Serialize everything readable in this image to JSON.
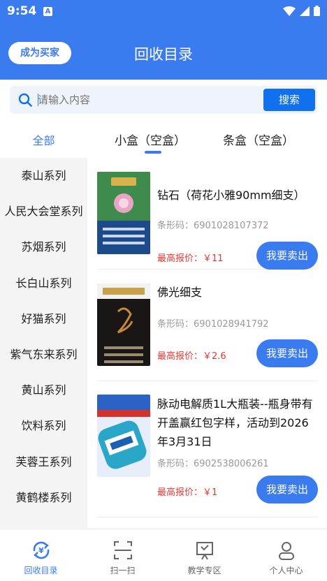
{
  "status_bar": {
    "time": "9:54",
    "notification_letter": "A"
  },
  "header": {
    "title": "回收目录",
    "buyer_button": "成为买家"
  },
  "search": {
    "placeholder": "请输入内容",
    "button": "搜索"
  },
  "tabs": {
    "all": "全部",
    "items": [
      "小盒（空盒）",
      "条盒（空盒）"
    ],
    "active_index": 0
  },
  "sidebar": {
    "items": [
      "泰山系列",
      "人民大会堂系列",
      "苏烟系列",
      "长白山系列",
      "好猫系列",
      "紫气东来系列",
      "黄山系列",
      "饮料系列",
      "芙蓉王系列",
      "黄鹤楼系列"
    ]
  },
  "products": [
    {
      "name": "钻石（荷花小雅90mm细支）",
      "code": "条形码：6901028107372",
      "price": "最高报价：￥11",
      "button": "我要卖出"
    },
    {
      "name": "佛光细支",
      "code": "条形码：6901028941792",
      "price": "最高报价：￥2.6",
      "button": "我要卖出"
    },
    {
      "name": "脉动电解质1L大瓶装--瓶身带有开盖赢红包字样，活动到2026年3月31日",
      "code": "条形码：6902538006261",
      "price": "最高报价：￥1",
      "button": "我要卖出"
    }
  ],
  "tabbar": {
    "items": [
      {
        "label": "回收目录",
        "icon": "recycle-catalog-icon",
        "active": true
      },
      {
        "label": "扫一扫",
        "icon": "scan-icon",
        "active": false
      },
      {
        "label": "教学专区",
        "icon": "teaching-icon",
        "active": false
      },
      {
        "label": "个人中心",
        "icon": "user-icon",
        "active": false
      }
    ]
  },
  "colors": {
    "primary": "#3b7bf0",
    "price": "#e53935",
    "sidebar_bg": "#f4f4f4"
  }
}
